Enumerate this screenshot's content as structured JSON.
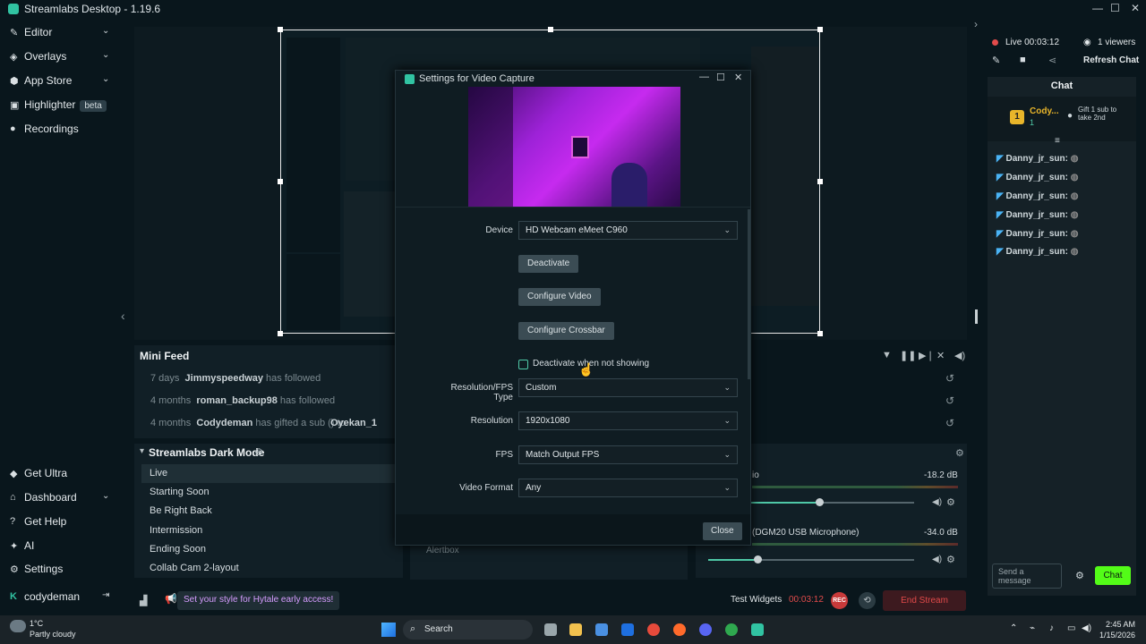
{
  "app": {
    "title": "Streamlabs Desktop - 1.19.6",
    "min": "—",
    "max": "☐",
    "close": "✕"
  },
  "sidebar": {
    "items": [
      {
        "label": "Editor",
        "icon": "✎"
      },
      {
        "label": "Overlays",
        "icon": "◈"
      },
      {
        "label": "App Store",
        "icon": "⬢"
      },
      {
        "label": "Highlighter",
        "icon": "▣",
        "badge": "beta"
      },
      {
        "label": "Recordings",
        "icon": "●"
      }
    ],
    "bottom": [
      {
        "label": "Get Ultra",
        "icon": "◆"
      },
      {
        "label": "Dashboard",
        "icon": "⌂"
      },
      {
        "label": "Get Help",
        "icon": "?"
      },
      {
        "label": "AI",
        "icon": "✦"
      },
      {
        "label": "Settings",
        "icon": "⚙"
      }
    ],
    "user": "codydeman"
  },
  "mini_feed": {
    "title": "Mini Feed",
    "rows": [
      {
        "time": "7 days",
        "name": "Jimmyspeedway",
        "text": "has followed"
      },
      {
        "time": "4 months",
        "name": "roman_backup98",
        "text": "has followed"
      },
      {
        "time": "4 months",
        "name": "Codydeman",
        "text": "has gifted a sub () to",
        "target": "Oyekan_1"
      }
    ]
  },
  "scenes": {
    "title": "Streamlabs Dark Mode",
    "items": [
      "Live",
      "Starting Soon",
      "Be Right Back",
      "Intermission",
      "Ending Soon",
      "Collab Cam 2-layout"
    ]
  },
  "sources": {
    "alertbox": "Alertbox"
  },
  "mixer": {
    "rows": [
      {
        "name": "io",
        "db": "-18.2 dB"
      },
      {
        "name": "(DGM20 USB Microphone)",
        "db": "-34.0 dB"
      }
    ]
  },
  "bottom_bar": {
    "promo": "Set your style for Hytale early access!",
    "test_widgets": "Test Widgets",
    "timer": "00:03:12",
    "rec": "REC",
    "end_stream": "End Stream"
  },
  "live": {
    "status": "Live 00:03:12",
    "viewers": "1 viewers",
    "refresh": "Refresh Chat"
  },
  "chat": {
    "title": "Chat",
    "top_user": "Cody...",
    "top_count": "1",
    "gift_text": "Gift 1 sub to take 2nd",
    "messages": [
      "Danny_jr_sun:",
      "Danny_jr_sun:",
      "Danny_jr_sun:",
      "Danny_jr_sun:",
      "Danny_jr_sun:",
      "Danny_jr_sun:"
    ],
    "placeholder": "Send a message",
    "send": "Chat"
  },
  "dialog": {
    "title": "Settings for Video Capture",
    "device_label": "Device",
    "device": "HD Webcam eMeet C960",
    "deactivate": "Deactivate",
    "configure_video": "Configure Video",
    "configure_crossbar": "Configure Crossbar",
    "deactivate_hidden": "Deactivate when not showing",
    "resfps_label": "Resolution/FPS Type",
    "resfps": "Custom",
    "resolution_label": "Resolution",
    "resolution": "1920x1080",
    "fps_label": "FPS",
    "fps": "Match Output FPS",
    "format_label": "Video Format",
    "format": "Any",
    "close": "Close"
  },
  "taskbar": {
    "temp": "1°C",
    "weather": "Partly cloudy",
    "search": "Search",
    "time": "2:45 AM",
    "date": "1/15/2026"
  }
}
